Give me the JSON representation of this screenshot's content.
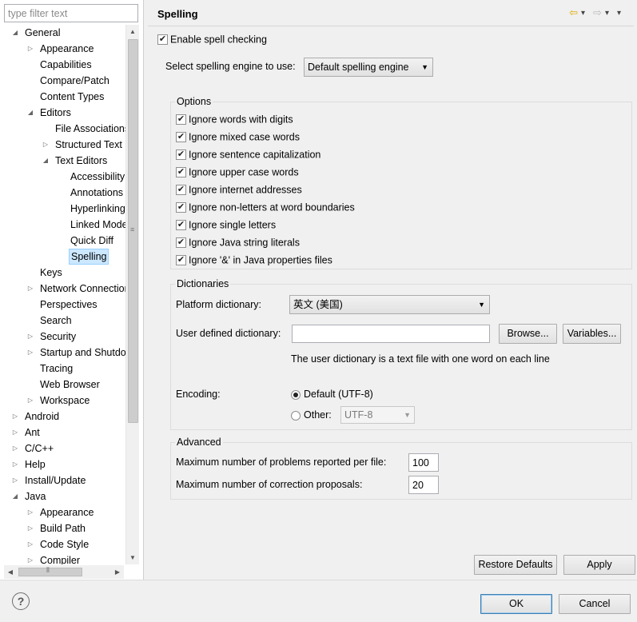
{
  "filter": {
    "placeholder": "type filter text"
  },
  "tree": [
    {
      "label": "General",
      "level": 0,
      "arrow": "expanded"
    },
    {
      "label": "Appearance",
      "level": 1,
      "arrow": "collapsed"
    },
    {
      "label": "Capabilities",
      "level": 1,
      "arrow": "none"
    },
    {
      "label": "Compare/Patch",
      "level": 1,
      "arrow": "none"
    },
    {
      "label": "Content Types",
      "level": 1,
      "arrow": "none"
    },
    {
      "label": "Editors",
      "level": 1,
      "arrow": "expanded"
    },
    {
      "label": "File Associations",
      "level": 2,
      "arrow": "none"
    },
    {
      "label": "Structured Text",
      "level": 2,
      "arrow": "collapsed"
    },
    {
      "label": "Text Editors",
      "level": 2,
      "arrow": "expanded"
    },
    {
      "label": "Accessibility",
      "level": 3,
      "arrow": "none"
    },
    {
      "label": "Annotations",
      "level": 3,
      "arrow": "none"
    },
    {
      "label": "Hyperlinking",
      "level": 3,
      "arrow": "none"
    },
    {
      "label": "Linked Mode",
      "level": 3,
      "arrow": "none"
    },
    {
      "label": "Quick Diff",
      "level": 3,
      "arrow": "none"
    },
    {
      "label": "Spelling",
      "level": 3,
      "arrow": "none",
      "selected": true
    },
    {
      "label": "Keys",
      "level": 1,
      "arrow": "none"
    },
    {
      "label": "Network Connections",
      "level": 1,
      "arrow": "collapsed"
    },
    {
      "label": "Perspectives",
      "level": 1,
      "arrow": "none"
    },
    {
      "label": "Search",
      "level": 1,
      "arrow": "none"
    },
    {
      "label": "Security",
      "level": 1,
      "arrow": "collapsed"
    },
    {
      "label": "Startup and Shutdown",
      "level": 1,
      "arrow": "collapsed"
    },
    {
      "label": "Tracing",
      "level": 1,
      "arrow": "none"
    },
    {
      "label": "Web Browser",
      "level": 1,
      "arrow": "none"
    },
    {
      "label": "Workspace",
      "level": 1,
      "arrow": "collapsed"
    },
    {
      "label": "Android",
      "level": 0,
      "arrow": "collapsed"
    },
    {
      "label": "Ant",
      "level": 0,
      "arrow": "collapsed"
    },
    {
      "label": "C/C++",
      "level": 0,
      "arrow": "collapsed"
    },
    {
      "label": "Help",
      "level": 0,
      "arrow": "collapsed"
    },
    {
      "label": "Install/Update",
      "level": 0,
      "arrow": "collapsed"
    },
    {
      "label": "Java",
      "level": 0,
      "arrow": "expanded"
    },
    {
      "label": "Appearance",
      "level": 1,
      "arrow": "collapsed"
    },
    {
      "label": "Build Path",
      "level": 1,
      "arrow": "collapsed"
    },
    {
      "label": "Code Style",
      "level": 1,
      "arrow": "collapsed"
    },
    {
      "label": "Compiler",
      "level": 1,
      "arrow": "collapsed"
    }
  ],
  "page": {
    "title": "Spelling",
    "enable_label": "Enable spell checking",
    "engine_label": "Select spelling engine to use:",
    "engine_value": "Default spelling engine"
  },
  "options": {
    "title": "Options",
    "items": [
      "Ignore words with digits",
      "Ignore mixed case words",
      "Ignore sentence capitalization",
      "Ignore upper case words",
      "Ignore internet addresses",
      "Ignore non-letters at word boundaries",
      "Ignore single letters",
      "Ignore Java string literals",
      "Ignore '&' in Java properties files"
    ]
  },
  "dictionaries": {
    "title": "Dictionaries",
    "platform_label": "Platform dictionary:",
    "platform_value": "英文 (美国)",
    "user_label": "User defined dictionary:",
    "user_value": "",
    "browse_label": "Browse...",
    "variables_label": "Variables...",
    "hint": "The user dictionary is a text file with one word on each line",
    "encoding_label": "Encoding:",
    "default_label": "Default (UTF-8)",
    "other_label": "Other:",
    "other_value": "UTF-8"
  },
  "advanced": {
    "title": "Advanced",
    "max_problems_label": "Maximum number of problems reported per file:",
    "max_problems_value": "100",
    "max_proposals_label": "Maximum number of correction proposals:",
    "max_proposals_value": "20"
  },
  "buttons": {
    "restore": "Restore Defaults",
    "apply": "Apply",
    "ok": "OK",
    "cancel": "Cancel"
  },
  "icons": {
    "help": "?",
    "back": "⇦",
    "forward": "⇨",
    "dropdown": "▾"
  },
  "colors": {
    "selection_bg": "#cce8ff",
    "default_button_border": "#3c7fb1"
  }
}
